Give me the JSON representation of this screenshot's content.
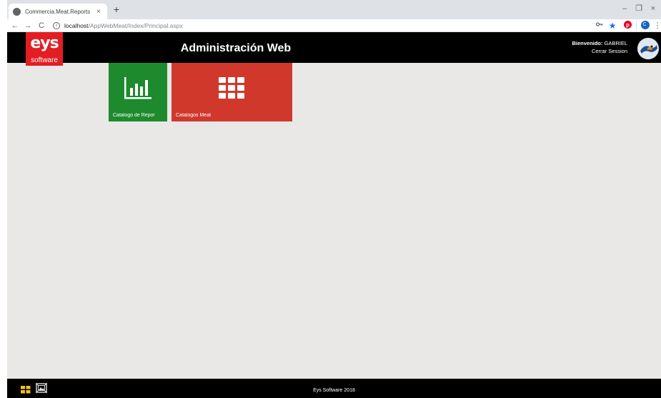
{
  "browser": {
    "tab_title": "Commercia.Meat.Reports",
    "tab_close": "×",
    "new_tab": "+",
    "minimize": "–",
    "restore": "❐",
    "close": "×",
    "back": "←",
    "forward": "→",
    "reload": "C",
    "url_host": "localhost",
    "url_path": "/AppWebMeat/Index/Principal.aspx",
    "profile_initial": "C",
    "icons": [
      "key-icon",
      "star-icon",
      "pinterest-icon",
      "profile-icon",
      "menu-icon"
    ]
  },
  "header": {
    "logo_mark": "eys",
    "logo_sub": "software",
    "title": "Administración Web",
    "welcome_label": "Bienvenido:",
    "username": "GABRIEL",
    "logout": "Cerrar Session"
  },
  "tiles": [
    {
      "label": "Catalogo de Repor",
      "color": "#1e8a2e",
      "icon": "bar-chart-icon"
    },
    {
      "label": "Catalogos Meat",
      "color": "#d0382c",
      "icon": "grid-icon"
    }
  ],
  "footer": {
    "text": "Eys Software 2018",
    "icons": [
      "tiles-icon",
      "picture-frame-icon"
    ]
  },
  "colors": {
    "header_bg": "#000000",
    "main_bg": "#e9e8e6",
    "logo_red": "#e21d24",
    "footer_icon_yellow": "#f2c314"
  }
}
